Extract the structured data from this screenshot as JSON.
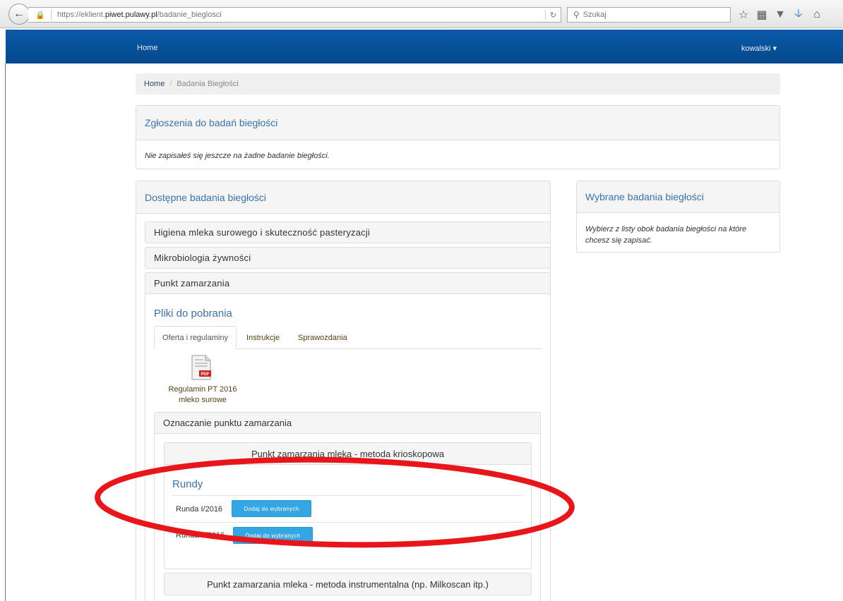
{
  "browser": {
    "url_prefix": "https://eklient.",
    "url_domain": "piwet.pulawy.pl",
    "url_path": "/badanie_bieglosci",
    "search_placeholder": "Szukaj",
    "icons": [
      "bookmark-star-icon",
      "reading-list-icon",
      "pocket-icon",
      "download-icon",
      "home-icon"
    ]
  },
  "navbar": {
    "home": "Home",
    "user": "kowalski ▾"
  },
  "breadcrumb": {
    "home": "Home",
    "separator": "/",
    "current": "Badania Biegłości"
  },
  "zgloszenia": {
    "title": "Zgłoszenia do badań biegłości",
    "message": "Nie zapisałeś się jeszcze na żadne badanie biegłości."
  },
  "dostepne": {
    "title": "Dostępne badania biegłości",
    "items": [
      "Higiena mleka surowego i skuteczność pasteryzacji",
      "Mikrobiologia żywności",
      "Punkt zamarzania"
    ],
    "files_title": "Pliki do pobrania",
    "tabs": [
      "Oferta i regulaminy",
      "Instrukcje",
      "Sprawozdania"
    ],
    "file_label_line1": "Regulamin PT 2016",
    "file_label_line2": "mleko surowe",
    "file_badge": "PDF",
    "subsection_title": "Oznaczanie punktu zamarzania",
    "methods": [
      "Punkt zamarzania mleka - metoda krioskopowa",
      "Punkt zamarzania mleka - metoda instrumentalna (np. Milkoscan itp.)"
    ],
    "rounds_title": "Rundy",
    "rounds": [
      {
        "label": "Runda I/2016",
        "button": "Dodaj do wybranych"
      },
      {
        "label": "Runda II/2016",
        "button": "Dodaj do wybranych"
      }
    ]
  },
  "wybrane": {
    "title": "Wybrane badania biegłości",
    "message": "Wybierz z listy obok badania biegłości na które chcesz się zapisać."
  },
  "colors": {
    "navbar": "#04488c",
    "link": "#3872b0",
    "button": "#33a6e3",
    "annotation": "#e8161b"
  }
}
